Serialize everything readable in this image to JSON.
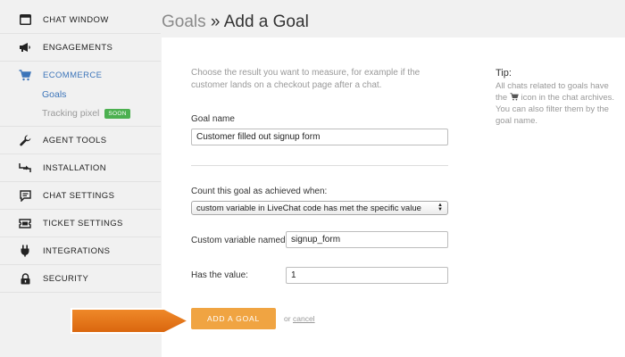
{
  "sidebar": {
    "items": [
      {
        "label": "CHAT WINDOW",
        "icon": "window-icon"
      },
      {
        "label": "ENGAGEMENTS",
        "icon": "megaphone-icon"
      },
      {
        "label": "ECOMMERCE",
        "icon": "cart-icon"
      },
      {
        "label": "AGENT TOOLS",
        "icon": "wrench-icon"
      },
      {
        "label": "INSTALLATION",
        "icon": "code-arrows-icon"
      },
      {
        "label": "CHAT SETTINGS",
        "icon": "chat-bubble-icon"
      },
      {
        "label": "TICKET SETTINGS",
        "icon": "ticket-icon"
      },
      {
        "label": "INTEGRATIONS",
        "icon": "plug-icon"
      },
      {
        "label": "SECURITY",
        "icon": "lock-icon"
      }
    ],
    "sub": {
      "goals": "Goals",
      "tracking": "Tracking pixel",
      "badge": "SOON"
    },
    "accent_color": "#3b74b9"
  },
  "header": {
    "crumb": "Goals",
    "separator": " » ",
    "title": "Add a Goal"
  },
  "form": {
    "intro": "Choose the result you want to measure, for example if the customer lands on a checkout page after a chat.",
    "goal_name_label": "Goal name",
    "goal_name_value": "Customer filled out signup form",
    "condition_label": "Count this goal as achieved when:",
    "condition_value": "custom variable in LiveChat code has met the specific value",
    "var_name_label": "Custom variable named:",
    "var_name_value": "signup_form",
    "value_label": "Has the value:",
    "value_value": "1",
    "submit_label": "ADD A GOAL",
    "or_text": "or",
    "cancel_label": "cancel",
    "submit_color": "#f0a442"
  },
  "tip": {
    "title": "Tip:",
    "text_before_icon": "All chats related to goals have the",
    "text_after_icon": "icon in the chat archives. You can also filter them by the goal name."
  },
  "annotation": {
    "arrow_color": "#e07215"
  }
}
